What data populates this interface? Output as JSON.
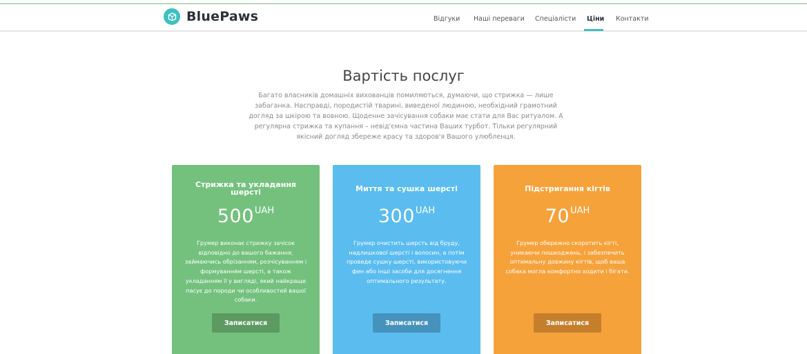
{
  "brand": {
    "name": "BluePaws",
    "logo_icon": "paw-box-icon",
    "accent": "#3ec0c0"
  },
  "nav": {
    "items": [
      {
        "label": "Відгуки",
        "active": false
      },
      {
        "label": "Наші переваги",
        "active": false
      },
      {
        "label": "Спеціалісти",
        "active": false
      },
      {
        "label": "Ціни",
        "active": true
      },
      {
        "label": "Контакти",
        "active": false
      }
    ]
  },
  "section": {
    "title": "Вартість послуг",
    "description": "Багато власників домашніх вихованців помиляються, думаючи, що стрижка — лише забаганка. Насправді, породистій тварині, виведеної людиною, необхідний грамотний догляд за шкірою та вовною. Щоденне зачісування собаки має стати для Вас ритуалом. А регулярна стрижка та купання – невід'ємна частина Ваших турбот. Тільки регулярний якісний догляд збереже красу та здоров'я Вашого улюбленця."
  },
  "cards": [
    {
      "title": "Стрижка та укладання шерсті",
      "price": "500",
      "currency": "UAH",
      "description": "Грумер виконає стрижку зачісок відповідно до вашого бажання, займаючись обрізанням, розчісуванням і формуванням шерсті, а також укладанням її у вигляді, який найкраще пасує до породи чи особливостей вашої собаки.",
      "button": "Записатися",
      "color": "#74c17e"
    },
    {
      "title": "Миття та сушка шерсті",
      "price": "300",
      "currency": "UAH",
      "description": "Грумер очистить шерсть від бруду, надлишкової шерсті і волосин, а потім проведе сушку шерсті, використовуючи фен або інші засоби для досягнення оптимального результату.",
      "button": "Записатися",
      "color": "#5bbcf0"
    },
    {
      "title": "Підстригання кігтів",
      "price": "70",
      "currency": "UAH",
      "description": "Грумер обережно скоротить кігті, уникаючи пошкоджень, і забезпечить оптимальну довжину кігтів, щоб ваша собака могла комфортно ходити і бігати.",
      "button": "Записатися",
      "color": "#f6a23b"
    }
  ]
}
